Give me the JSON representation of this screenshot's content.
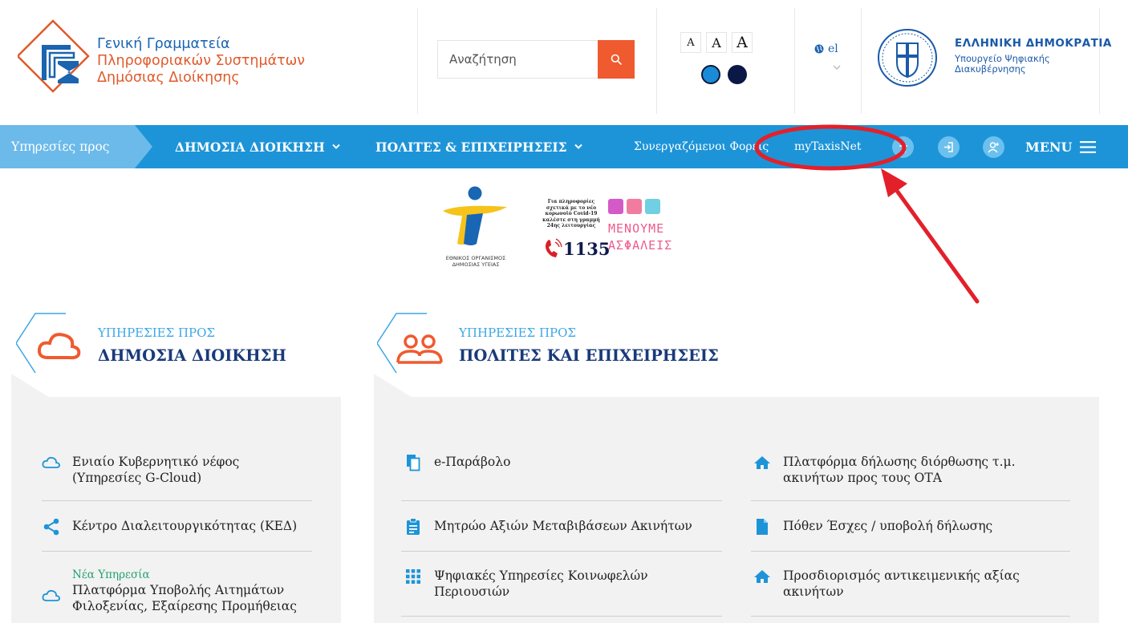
{
  "header": {
    "logo_lines": [
      "Γενική Γραμματεία",
      "Πληροφοριακών Συστημάτων",
      "Δημόσιας Διοίκησης"
    ],
    "search_placeholder": "Αναζήτηση",
    "font_sizes": [
      "A",
      "A",
      "A"
    ],
    "themes": [
      {
        "name": "blue",
        "color": "#1a8bd6"
      },
      {
        "name": "dark",
        "color": "#0b1745"
      }
    ],
    "language": "el",
    "gov_title": "ΕΛΛΗΝΙΚΗ ΔΗΜΟΚΡΑΤΙΑ",
    "gov_ministry_lines": [
      "Υπουργείο Ψηφιακής",
      "Διακυβέρνησης"
    ]
  },
  "nav": {
    "services_label": "Υπηρεσίες προς",
    "public_admin": "ΔΗΜΟΣΙΑ ΔΙΟΙΚΗΣΗ",
    "citizens": "ΠΟΛΙΤΕΣ & ΕΠΙΧΕΙΡΗΣΕΙΣ",
    "partners": "Συνεργαζόμενοι Φορείς",
    "mytaxisnet": "myTaxisNet",
    "menu": "MENU"
  },
  "banner": {
    "eody_lines": [
      "ΕΘΝΙΚΟΣ ΟΡΓΑΝΙΣΜΟΣ",
      "ΔΗΜΟΣΙΑΣ ΥΓΕΙΑΣ"
    ],
    "covid_info_lines": [
      "Για πληροφορίες",
      "σχετικά με το νέο",
      "κορωνοϊό Covid-19",
      "καλέστε στη γραμμή",
      "24ης λειτουργίας"
    ],
    "hotline": "1135",
    "stay_safe_lines": [
      "ΜΕΝΟΥΜΕ",
      "ΑΣΦΑΛΕΙΣ"
    ]
  },
  "sections": {
    "public": {
      "kicker": "ΥΠΗΡΕΣΙΕΣ ΠΡΟΣ",
      "title": "ΔΗΜΟΣΙΑ ΔΙΟΙΚΗΣΗ",
      "items": [
        {
          "label": "Ενιαίο Κυβερνητικό νέφος\n(Υπηρεσίες G-Cloud)",
          "icon": "cloud-icon"
        },
        {
          "label": "Κέντρο Διαλειτουργικότητας (ΚΕΔ)",
          "icon": "share-icon"
        },
        {
          "badge": "Νέα Υπηρεσία",
          "label": "Πλατφόρμα Υποβολής Αιτημάτων\nΦιλοξενίας, Εξαίρεσης Προμήθειας",
          "icon": "cloud-icon"
        }
      ]
    },
    "citizens": {
      "kicker": "ΥΠΗΡΕΣΙΕΣ ΠΡΟΣ",
      "title": "ΠΟΛΙΤΕΣ ΚΑΙ ΕΠΙΧΕΙΡΗΣΕΙΣ",
      "items_left": [
        {
          "label": "e-Παράβολο",
          "icon": "copy-icon"
        },
        {
          "label": "Μητρώο Αξιών Μεταβιβάσεων Ακινήτων",
          "icon": "clipboard-icon"
        },
        {
          "label": "Ψηφιακές Υπηρεσίες Κοινωφελών\nΠεριουσιών",
          "icon": "grid-icon"
        }
      ],
      "items_right": [
        {
          "label": "Πλατφόρμα δήλωσης διόρθωσης τ.μ.\nακινήτων προς τους ΟΤΑ",
          "icon": "home-icon"
        },
        {
          "label": "Πόθεν Έσχες / υποβολή δήλωσης",
          "icon": "file-icon"
        },
        {
          "label": "Προσδιορισμός αντικειμενικής αξίας\nακινήτων",
          "icon": "home-icon"
        }
      ]
    }
  },
  "colors": {
    "nav": "#1d94d8",
    "accent": "#ef5a2f",
    "annotation": "#e3202a",
    "title": "#193a7a"
  }
}
